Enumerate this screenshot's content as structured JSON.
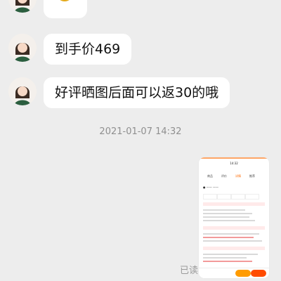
{
  "chat": {
    "messages": [
      {
        "sender": "agent",
        "type": "emoji"
      },
      {
        "sender": "agent",
        "type": "text",
        "text": "到手价469"
      },
      {
        "sender": "agent",
        "type": "text",
        "text": "好评晒图后面可以返30的哦"
      }
    ],
    "timestamp": "2021-01-07 14:32",
    "read_status": "已读",
    "colors": {
      "background": "#ededed",
      "bubble": "#ffffff",
      "brand": "#ff6a00",
      "text": "#111111"
    },
    "screenshot_tabs": [
      "商品",
      "评价",
      "详情",
      "推荐"
    ]
  }
}
